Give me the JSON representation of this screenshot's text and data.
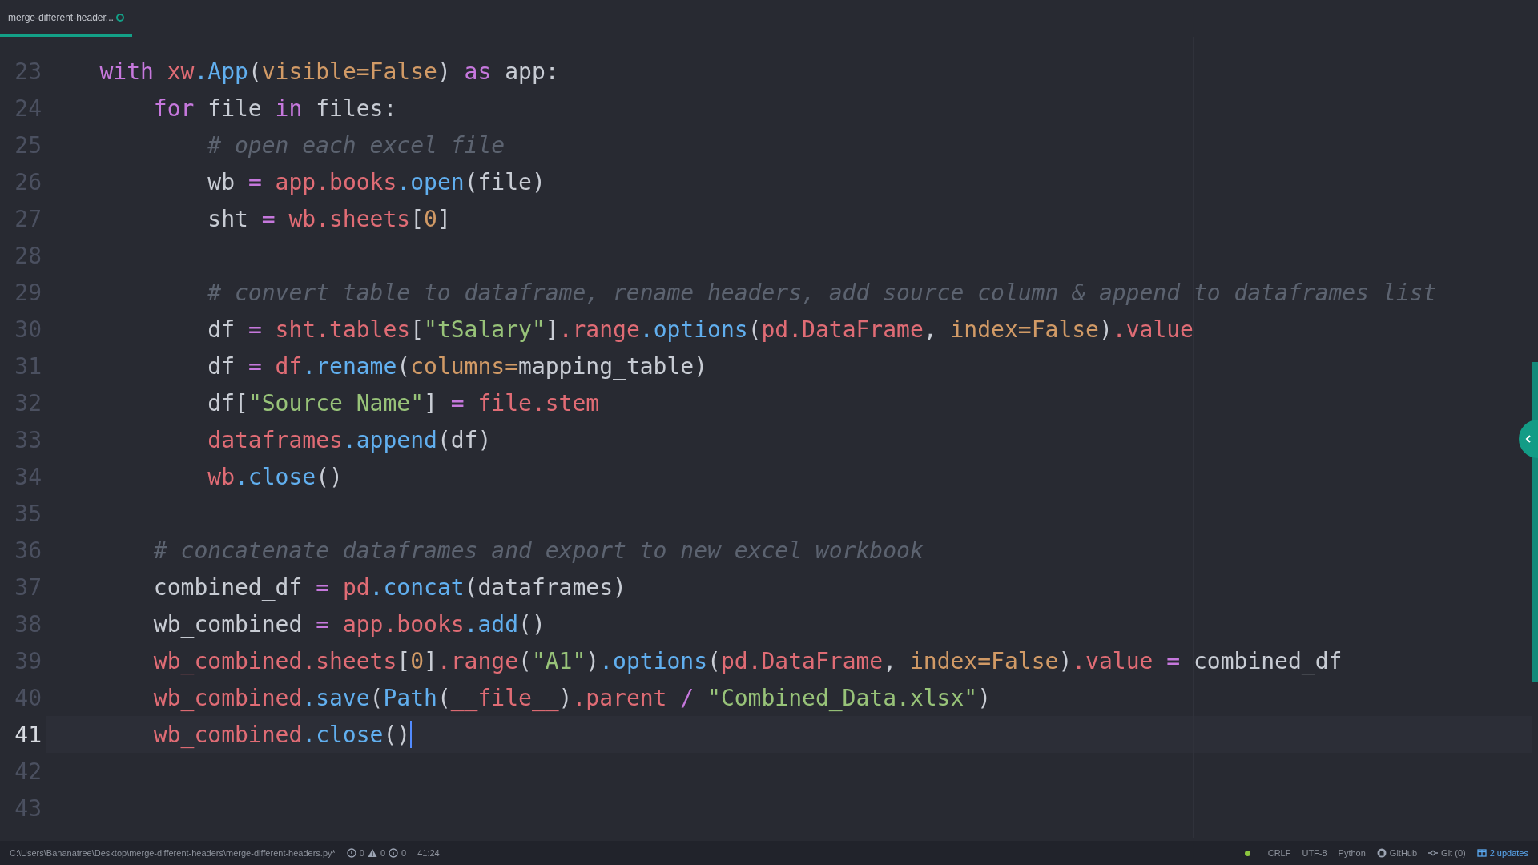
{
  "tab": {
    "title": "merge-different-header...",
    "modified": true,
    "selected": true
  },
  "editor": {
    "lines": [
      {
        "number": "23",
        "current": false,
        "tokens": [
          {
            "kind": "kw",
            "text": "    with "
          },
          {
            "kind": "var",
            "text": "xw"
          },
          {
            "kind": "fn",
            "text": ".App"
          },
          {
            "kind": "plain",
            "text": "("
          },
          {
            "kind": "param",
            "text": "visible=False"
          },
          {
            "kind": "plain",
            "text": ") "
          },
          {
            "kind": "kw",
            "text": "as"
          },
          {
            "kind": "plain",
            "text": " app:"
          }
        ]
      },
      {
        "number": "24",
        "current": false,
        "tokens": [
          {
            "kind": "kw",
            "text": "        for"
          },
          {
            "kind": "plain",
            "text": " file "
          },
          {
            "kind": "kw",
            "text": "in"
          },
          {
            "kind": "plain",
            "text": " files:"
          }
        ]
      },
      {
        "number": "25",
        "current": false,
        "tokens": [
          {
            "kind": "cm",
            "text": "            # open each excel file"
          }
        ]
      },
      {
        "number": "26",
        "current": false,
        "tokens": [
          {
            "kind": "plain",
            "text": "            wb "
          },
          {
            "kind": "op",
            "text": "= "
          },
          {
            "kind": "var",
            "text": "app"
          },
          {
            "kind": "var",
            "text": ".books"
          },
          {
            "kind": "fn",
            "text": ".open"
          },
          {
            "kind": "plain",
            "text": "(file)"
          }
        ]
      },
      {
        "number": "27",
        "current": false,
        "tokens": [
          {
            "kind": "plain",
            "text": "            sht "
          },
          {
            "kind": "op",
            "text": "= "
          },
          {
            "kind": "var",
            "text": "wb"
          },
          {
            "kind": "var",
            "text": ".sheets"
          },
          {
            "kind": "plain",
            "text": "["
          },
          {
            "kind": "num",
            "text": "0"
          },
          {
            "kind": "plain",
            "text": "]"
          }
        ]
      },
      {
        "number": "28",
        "current": false
      },
      {
        "number": "29",
        "current": false,
        "tokens": [
          {
            "kind": "cm",
            "text": "            # convert table to dataframe, rename headers, add source column & append to dataframes list"
          }
        ]
      },
      {
        "number": "30",
        "current": false,
        "tokens": [
          {
            "kind": "plain",
            "text": "            df "
          },
          {
            "kind": "op",
            "text": "= "
          },
          {
            "kind": "var",
            "text": "sht"
          },
          {
            "kind": "var",
            "text": ".tables"
          },
          {
            "kind": "plain",
            "text": "["
          },
          {
            "kind": "str",
            "text": "\"tSalary\""
          },
          {
            "kind": "plain",
            "text": "]"
          },
          {
            "kind": "var",
            "text": ".range"
          },
          {
            "kind": "fn",
            "text": ".options"
          },
          {
            "kind": "plain",
            "text": "("
          },
          {
            "kind": "var",
            "text": "pd"
          },
          {
            "kind": "var",
            "text": ".DataFrame"
          },
          {
            "kind": "plain",
            "text": ", "
          },
          {
            "kind": "param",
            "text": "index=False"
          },
          {
            "kind": "plain",
            "text": ")"
          },
          {
            "kind": "var",
            "text": ".value"
          }
        ]
      },
      {
        "number": "31",
        "current": false,
        "tokens": [
          {
            "kind": "plain",
            "text": "            df "
          },
          {
            "kind": "op",
            "text": "= "
          },
          {
            "kind": "var",
            "text": "df"
          },
          {
            "kind": "fn",
            "text": ".rename"
          },
          {
            "kind": "plain",
            "text": "("
          },
          {
            "kind": "param",
            "text": "columns="
          },
          {
            "kind": "plain",
            "text": "mapping_table)"
          }
        ]
      },
      {
        "number": "32",
        "current": false,
        "tokens": [
          {
            "kind": "plain",
            "text": "            df["
          },
          {
            "kind": "str",
            "text": "\"Source Name\""
          },
          {
            "kind": "plain",
            "text": "] "
          },
          {
            "kind": "op",
            "text": "= "
          },
          {
            "kind": "var",
            "text": "file"
          },
          {
            "kind": "var",
            "text": ".stem"
          }
        ]
      },
      {
        "number": "33",
        "current": false,
        "tokens": [
          {
            "kind": "var",
            "text": "            dataframes"
          },
          {
            "kind": "fn",
            "text": ".append"
          },
          {
            "kind": "plain",
            "text": "(df)"
          }
        ]
      },
      {
        "number": "34",
        "current": false,
        "tokens": [
          {
            "kind": "var",
            "text": "            wb"
          },
          {
            "kind": "fn",
            "text": ".close"
          },
          {
            "kind": "plain",
            "text": "()"
          }
        ]
      },
      {
        "number": "35",
        "current": false
      },
      {
        "number": "36",
        "current": false,
        "tokens": [
          {
            "kind": "cm",
            "text": "        # concatenate dataframes and export to new excel workbook"
          }
        ]
      },
      {
        "number": "37",
        "current": false,
        "tokens": [
          {
            "kind": "plain",
            "text": "        combined_df "
          },
          {
            "kind": "op",
            "text": "= "
          },
          {
            "kind": "var",
            "text": "pd"
          },
          {
            "kind": "fn",
            "text": ".concat"
          },
          {
            "kind": "plain",
            "text": "(dataframes)"
          }
        ]
      },
      {
        "number": "38",
        "current": false,
        "tokens": [
          {
            "kind": "plain",
            "text": "        wb_combined "
          },
          {
            "kind": "op",
            "text": "= "
          },
          {
            "kind": "var",
            "text": "app"
          },
          {
            "kind": "var",
            "text": ".books"
          },
          {
            "kind": "fn",
            "text": ".add"
          },
          {
            "kind": "plain",
            "text": "()"
          }
        ]
      },
      {
        "number": "39",
        "current": false,
        "tokens": [
          {
            "kind": "var",
            "text": "        wb_combined"
          },
          {
            "kind": "var",
            "text": ".sheets"
          },
          {
            "kind": "plain",
            "text": "["
          },
          {
            "kind": "num",
            "text": "0"
          },
          {
            "kind": "plain",
            "text": "]"
          },
          {
            "kind": "var",
            "text": ".range"
          },
          {
            "kind": "plain",
            "text": "("
          },
          {
            "kind": "str",
            "text": "\"A1\""
          },
          {
            "kind": "plain",
            "text": ")"
          },
          {
            "kind": "fn",
            "text": ".options"
          },
          {
            "kind": "plain",
            "text": "("
          },
          {
            "kind": "var",
            "text": "pd"
          },
          {
            "kind": "var",
            "text": ".DataFrame"
          },
          {
            "kind": "plain",
            "text": ", "
          },
          {
            "kind": "param",
            "text": "index=False"
          },
          {
            "kind": "plain",
            "text": ")"
          },
          {
            "kind": "var",
            "text": ".value "
          },
          {
            "kind": "op",
            "text": "="
          },
          {
            "kind": "plain",
            "text": " combined_df"
          }
        ]
      },
      {
        "number": "40",
        "current": false,
        "tokens": [
          {
            "kind": "var",
            "text": "        wb_combined"
          },
          {
            "kind": "fn",
            "text": ".save"
          },
          {
            "kind": "plain",
            "text": "("
          },
          {
            "kind": "fn",
            "text": "Path"
          },
          {
            "kind": "plain",
            "text": "("
          },
          {
            "kind": "var",
            "text": "__file__"
          },
          {
            "kind": "plain",
            "text": ")"
          },
          {
            "kind": "var",
            "text": ".parent "
          },
          {
            "kind": "op",
            "text": "/ "
          },
          {
            "kind": "str",
            "text": "\"Combined_Data.xlsx\""
          },
          {
            "kind": "plain",
            "text": ")"
          }
        ]
      },
      {
        "number": "41",
        "current": true,
        "tokens": [
          {
            "kind": "var",
            "text": "        wb_combined"
          },
          {
            "kind": "fn",
            "text": ".close"
          },
          {
            "kind": "plain",
            "text": "()"
          }
        ]
      },
      {
        "number": "42",
        "current": false
      },
      {
        "number": "43",
        "current": false
      }
    ]
  },
  "status_bar": {
    "path": "C:\\Users\\Bananatree\\Desktop\\merge-different-headers\\merge-different-headers.py*",
    "errors": "0",
    "warnings": "0",
    "infos": "0",
    "cursor": "41:24",
    "line_ending": "CRLF",
    "encoding": "UTF-8",
    "language": "Python",
    "github": "GitHub",
    "git": "Git (0)",
    "updates": "2 updates"
  }
}
